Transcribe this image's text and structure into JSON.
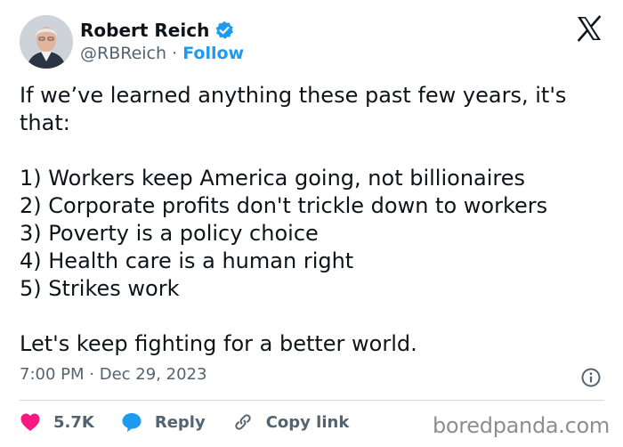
{
  "author": {
    "name": "Robert Reich",
    "handle": "@RBReich",
    "separator": "·",
    "follow_label": "Follow"
  },
  "tweet": {
    "text": "If we’ve learned anything these past few years, it's that:\n\n1) Workers keep America going, not billionaires\n2) Corporate profits don't trickle down to workers\n3) Poverty is a policy choice\n4) Health care is a human right\n5) Strikes work\n\nLet's keep fighting for a better world.",
    "time": "7:00 PM",
    "date_separator": "·",
    "date": "Dec 29, 2023"
  },
  "actions": {
    "likes_count": "5.7K",
    "reply_label": "Reply",
    "copy_link_label": "Copy link"
  },
  "watermark": "boredpanda.com",
  "colors": {
    "text": "#0f1419",
    "secondary": "#536471",
    "accent": "#1d9bf0",
    "like": "#f91880",
    "divider": "#cfd9de"
  },
  "icons": {
    "verified": "verified-badge-icon",
    "platform": "x-logo-icon",
    "info": "info-icon",
    "like": "heart-icon",
    "reply": "speech-bubble-icon",
    "copy": "link-icon"
  }
}
